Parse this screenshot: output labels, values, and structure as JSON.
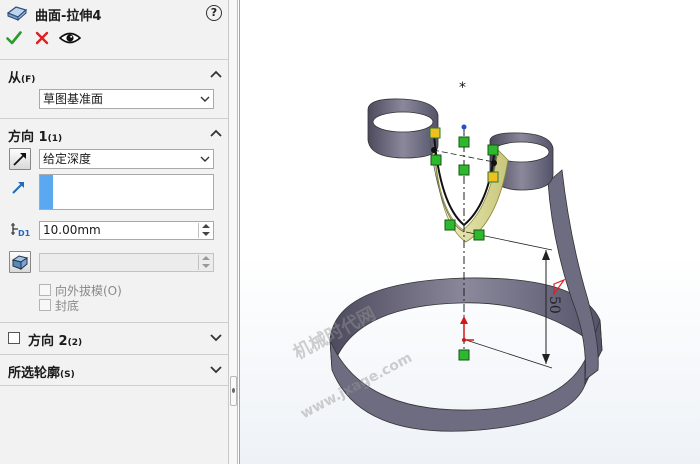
{
  "feature": {
    "title": "曲面-拉伸4"
  },
  "help": {
    "label": "?"
  },
  "from": {
    "label": "从",
    "shortcut": "(F)",
    "value": "草图基准面"
  },
  "direction1": {
    "label": "方向 1",
    "shortcut": "(1)",
    "end_condition": "给定深度",
    "depth": "10.00mm",
    "draft_label": "向外拔模(O)",
    "cap_label": "封底"
  },
  "direction2": {
    "label": "方向 2",
    "shortcut": "(2)"
  },
  "contours": {
    "label": "所选轮廓",
    "shortcut": "(S)"
  },
  "viewport": {
    "dimension": "50",
    "watermark_cn": "机械时代网",
    "watermark_en": "www.jxage.com"
  },
  "colors": {
    "accent": "#59a8f0",
    "surface": "#6a6878",
    "handle": "#2eb82e",
    "ok": "#2c9a2c",
    "cancel": "#e02020"
  }
}
